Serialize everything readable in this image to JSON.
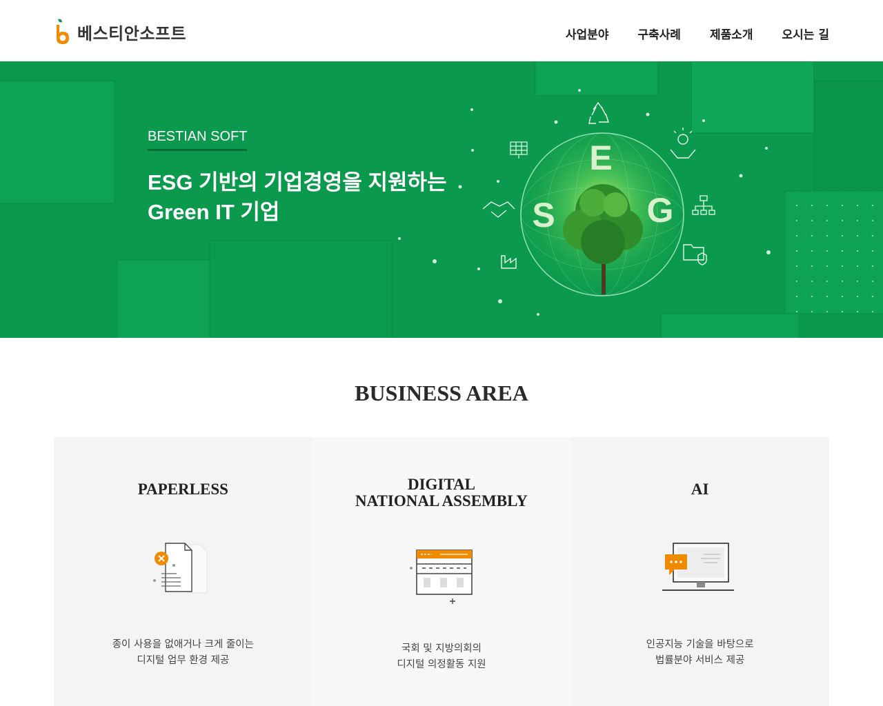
{
  "header": {
    "logo_text": "베스티안소프트",
    "nav": [
      {
        "label": "사업분야"
      },
      {
        "label": "구축사례"
      },
      {
        "label": "제품소개"
      },
      {
        "label": "오시는 길"
      }
    ]
  },
  "hero": {
    "kicker": "BESTIAN SOFT",
    "title_line1": "ESG 기반의 기업경영을 지원하는",
    "title_line2": "Green IT 기업",
    "esg_letters": [
      "E",
      "S",
      "G"
    ]
  },
  "business": {
    "title": "BUSINESS AREA",
    "cards": [
      {
        "title_lines": [
          "PAPERLESS"
        ],
        "icon": "paper-document-icon",
        "desc_lines": [
          "종이 사용을 없애거나 크게 줄이는",
          "디지털 업무 환경 제공"
        ]
      },
      {
        "title_lines": [
          "DIGITAL",
          "NATIONAL ASSEMBLY"
        ],
        "icon": "browser-window-icon",
        "desc_lines": [
          "국회 및 지방의회의",
          "디지털 의정활동 지원"
        ]
      },
      {
        "title_lines": [
          "AI"
        ],
        "icon": "monitor-chat-icon",
        "desc_lines": [
          "인공지능 기술을 바탕으로",
          "법률분야 서비스 제공"
        ]
      }
    ]
  },
  "colors": {
    "brand_green": "#0b9a4d",
    "brand_orange": "#f08a00"
  }
}
